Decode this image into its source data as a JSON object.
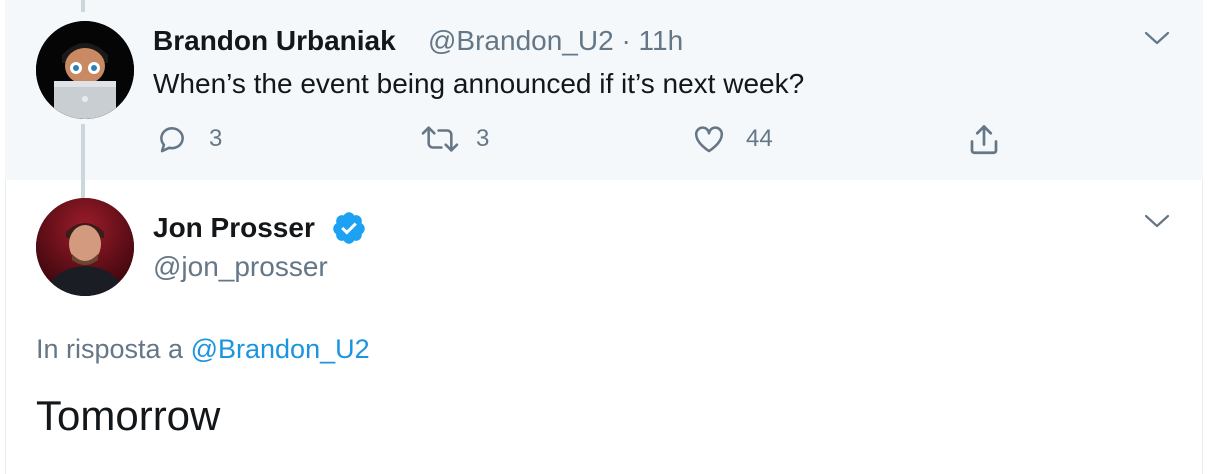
{
  "parent_tweet": {
    "name": "Brandon Urbaniak",
    "handle": "@Brandon_U2",
    "separator": "·",
    "time": "11h",
    "text": "When’s the event being announced if it’s next week?",
    "replies": "3",
    "retweets": "3",
    "likes": "44"
  },
  "main_tweet": {
    "name": "Jon Prosser",
    "handle": "@jon_prosser",
    "reply_prefix": "In risposta a",
    "reply_to_handle": "@Brandon_U2",
    "text": "Tomorrow"
  },
  "colors": {
    "accent": "#1da1f2",
    "link": "#1b95e0",
    "muted": "#657786",
    "text": "#14171a",
    "parent_bg": "#f5f8fa"
  },
  "icons": {
    "reply": "reply-icon",
    "retweet": "retweet-icon",
    "like": "heart-icon",
    "share": "share-icon",
    "menu": "chevron-down-icon",
    "verified": "verified-badge-icon"
  }
}
